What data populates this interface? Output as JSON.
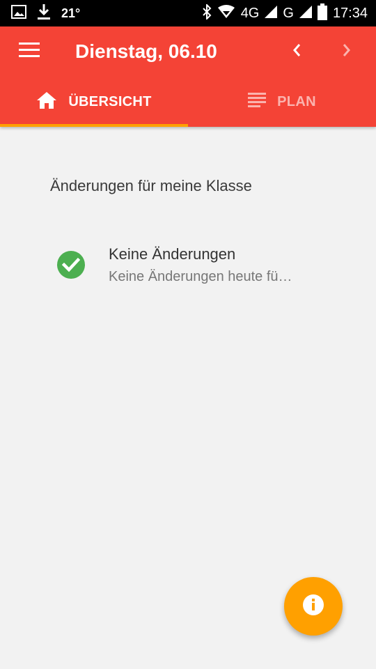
{
  "status_bar": {
    "temperature": "21°",
    "network_4g": "4G",
    "network_g": "G",
    "time": "17:34",
    "icons": [
      "image-icon",
      "download-icon",
      "bluetooth-icon",
      "wifi-icon",
      "signal-icon",
      "battery-icon"
    ]
  },
  "toolbar": {
    "title": "Dienstag, 06.10",
    "menu_icon": "menu-icon",
    "prev_icon": "chevron-left-icon",
    "next_icon": "chevron-right-icon"
  },
  "tabs": [
    {
      "label": "ÜBERSICHT",
      "icon": "home-icon",
      "active": true
    },
    {
      "label": "PLAN",
      "icon": "list-icon",
      "active": false
    }
  ],
  "main": {
    "section_title": "Änderungen für meine Klasse",
    "items": [
      {
        "title": "Keine Änderungen",
        "subtitle": "Keine Änderungen heute fü…",
        "icon": "check-circle-icon"
      }
    ]
  },
  "fab": {
    "icon": "info-icon"
  },
  "colors": {
    "primary": "#f44336",
    "accent": "#ffa000",
    "success": "#4caf50",
    "background": "#f2f2f2"
  }
}
